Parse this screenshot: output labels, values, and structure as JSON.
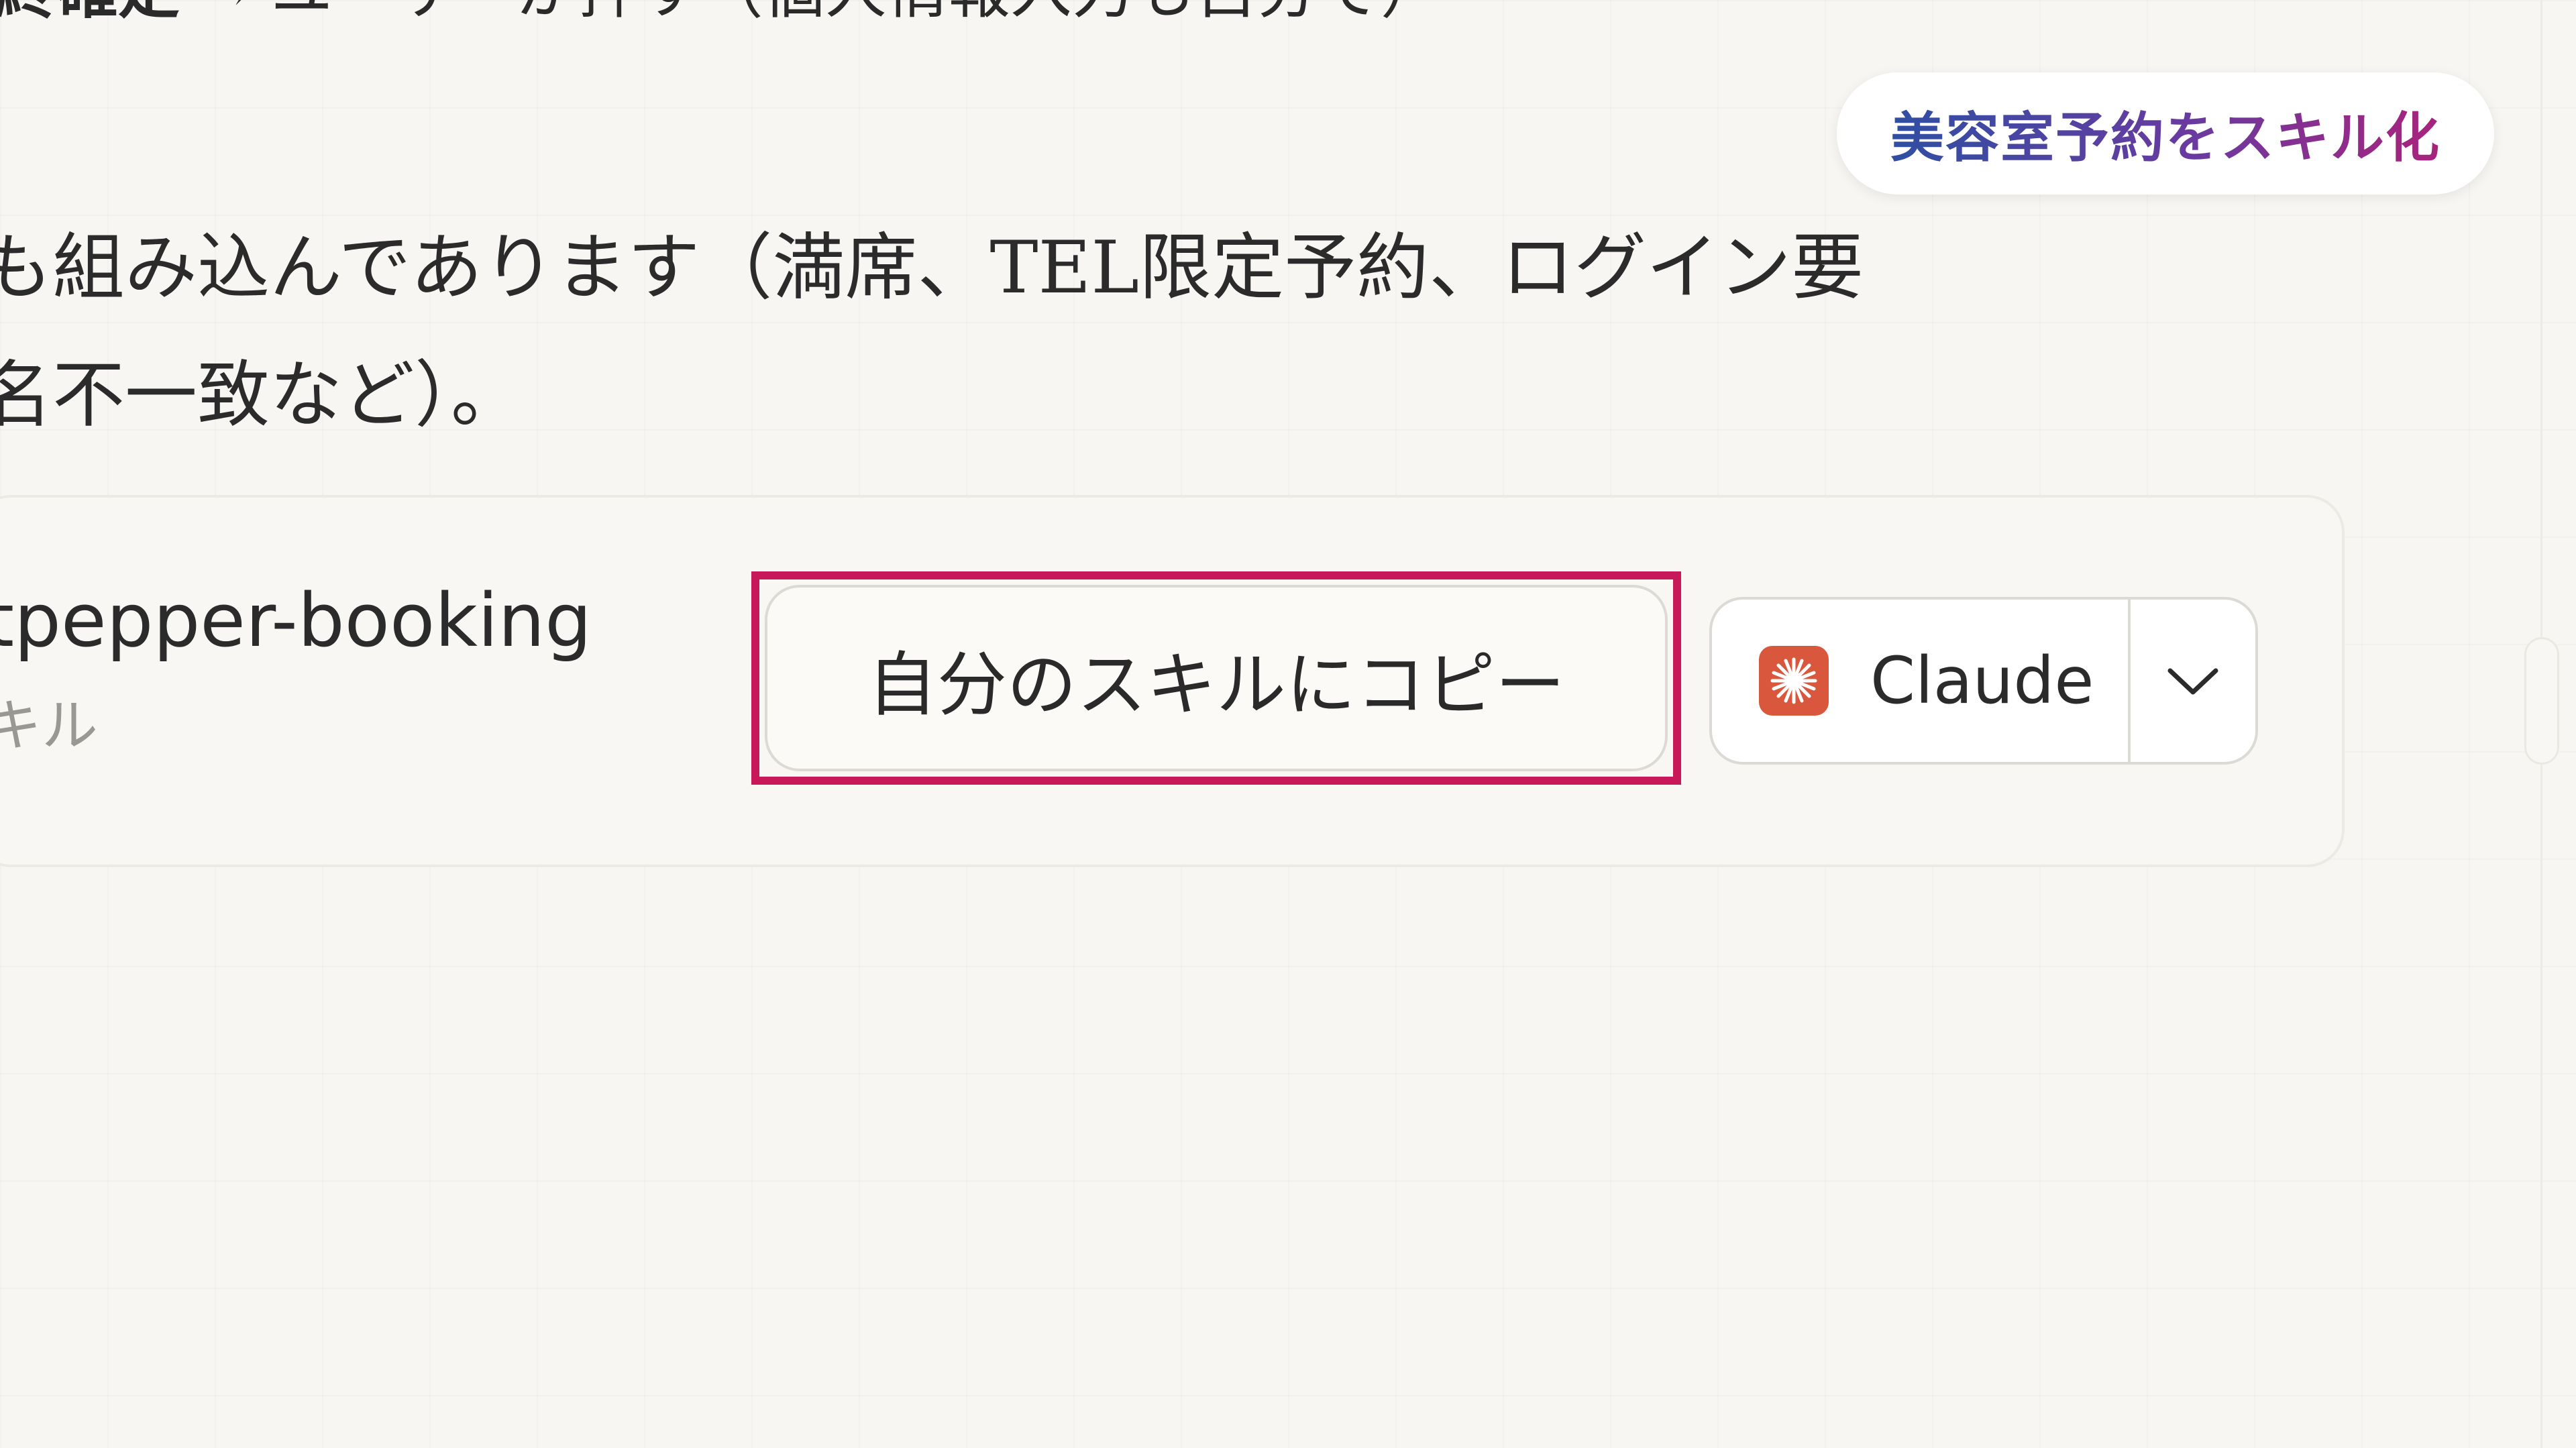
{
  "intro": {
    "top_line_bold": "終確定",
    "top_line_rest": " → ユーザーが押す（個人情報入力も自分で）",
    "paragraph_line1": "も組み込んであります（満席、TEL限定予約、ログイン要",
    "paragraph_line2": "名不一致など）。"
  },
  "badge": {
    "label": "美容室予約をスキル化"
  },
  "skill_card": {
    "name": "tpepper-booking",
    "type": "キル",
    "copy_button_label": "自分のスキルにコピー",
    "model_selector": {
      "selected": "Claude",
      "logo_icon": "claude-sunburst-icon",
      "chevron_icon": "chevron-down-icon"
    }
  },
  "colors": {
    "highlight": "#c8185a",
    "badge_gradient_start": "#2f4fa3",
    "badge_gradient_end": "#a8237c",
    "claude_logo": "#d9573c"
  }
}
